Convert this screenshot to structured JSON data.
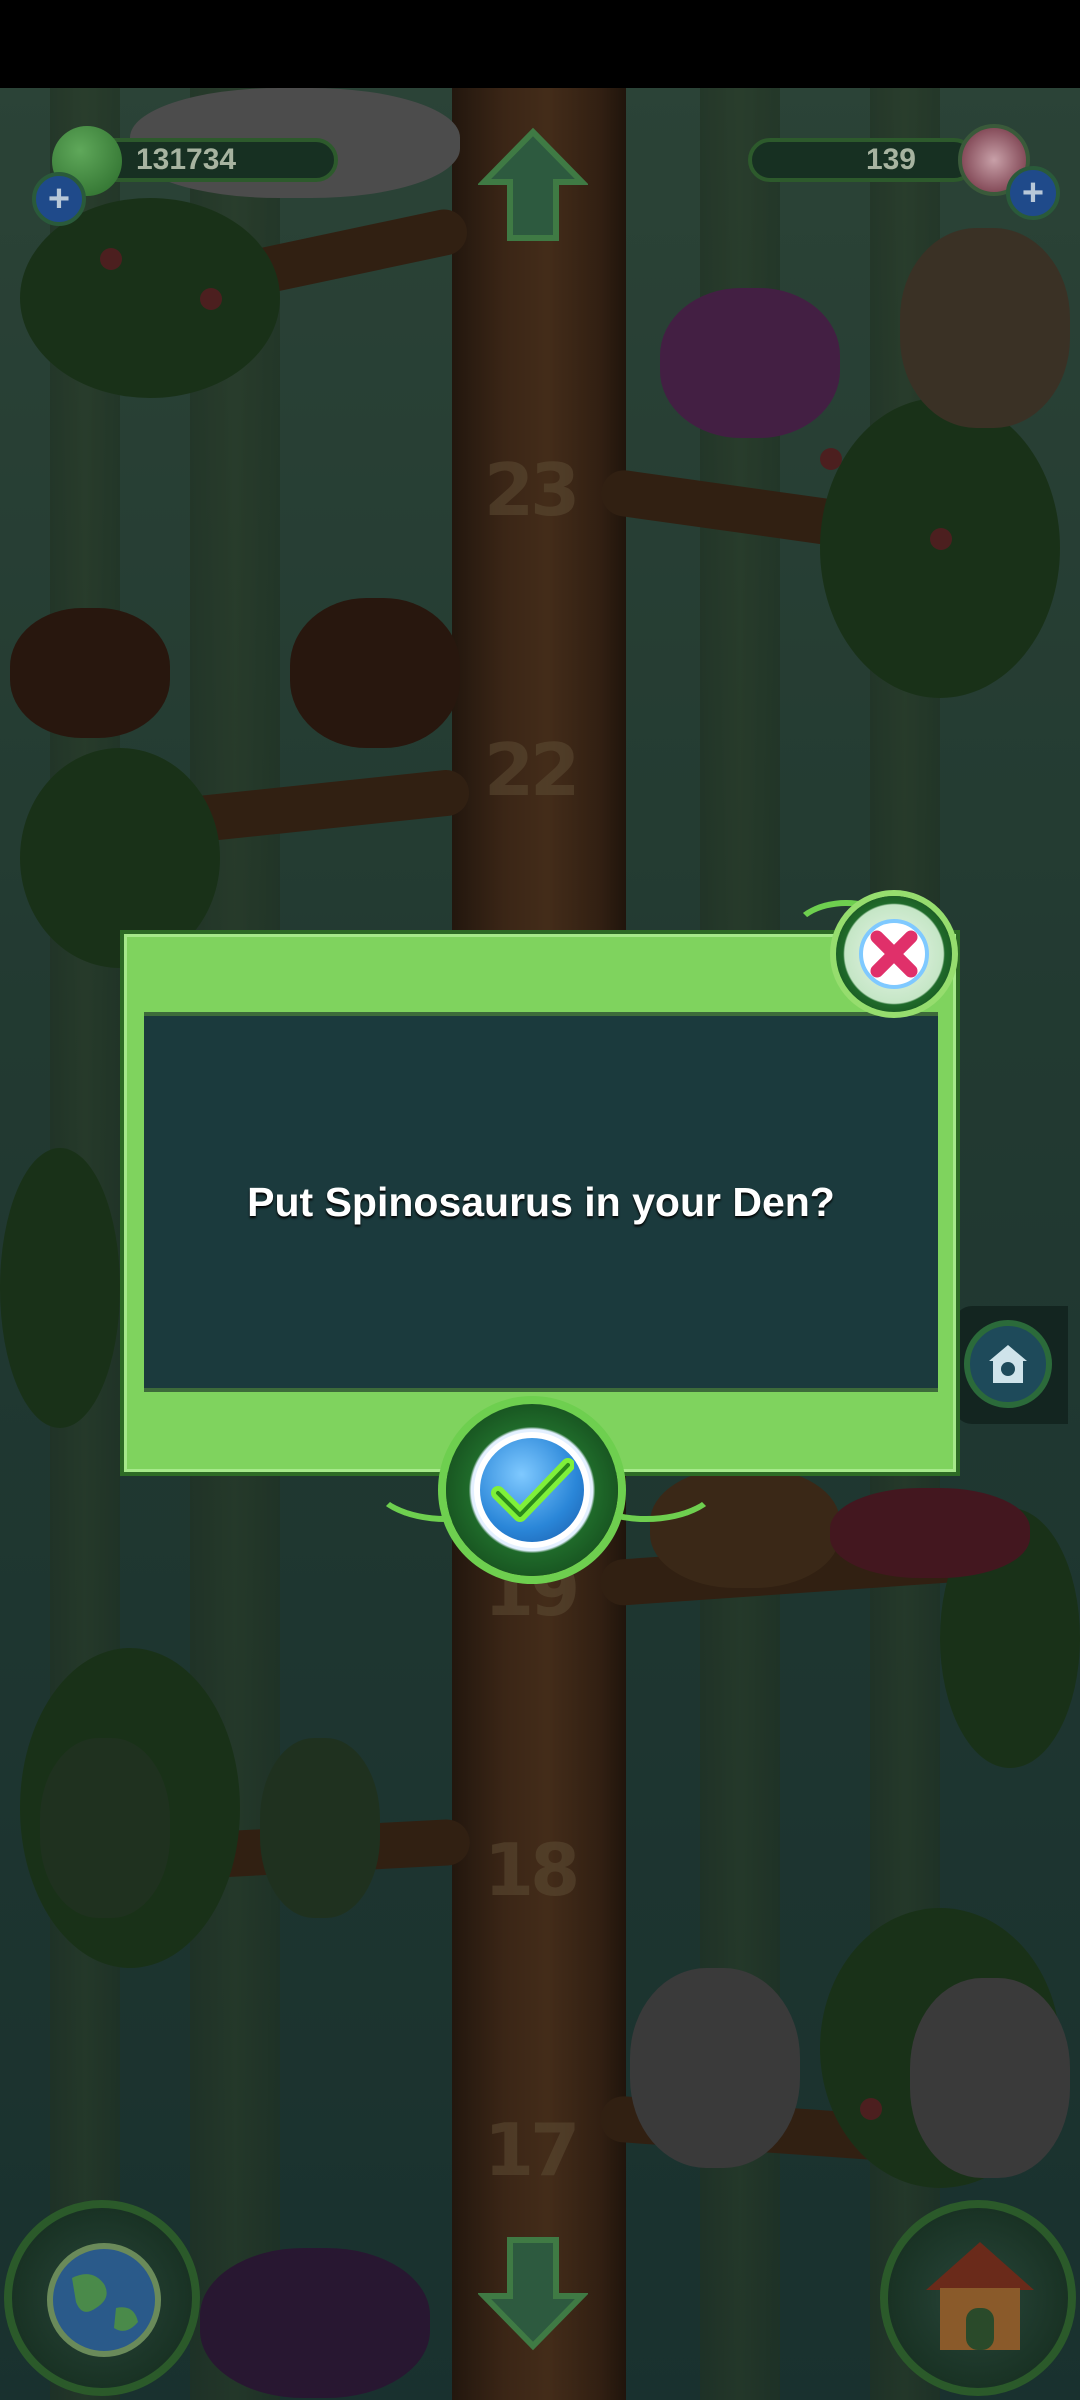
{
  "hud": {
    "gems_count": "131734",
    "crystals_count": "139"
  },
  "tree": {
    "levels": [
      "23",
      "22",
      "19",
      "18",
      "17"
    ]
  },
  "dialog": {
    "message": "Put Spinosaurus in your Den?"
  },
  "icons": {
    "gem": "green-gem-icon",
    "crystal": "red-crystal-icon",
    "close": "close-x-icon",
    "confirm": "checkmark-icon",
    "up": "up-arrow-icon",
    "down": "down-arrow-icon",
    "globe": "globe-icon",
    "den": "den-house-icon"
  },
  "colors": {
    "dialog_green": "#7fd35e",
    "dialog_panel": "#1b3a3d",
    "close_x": "#e0306a",
    "confirm_blue": "#2a86d8"
  }
}
